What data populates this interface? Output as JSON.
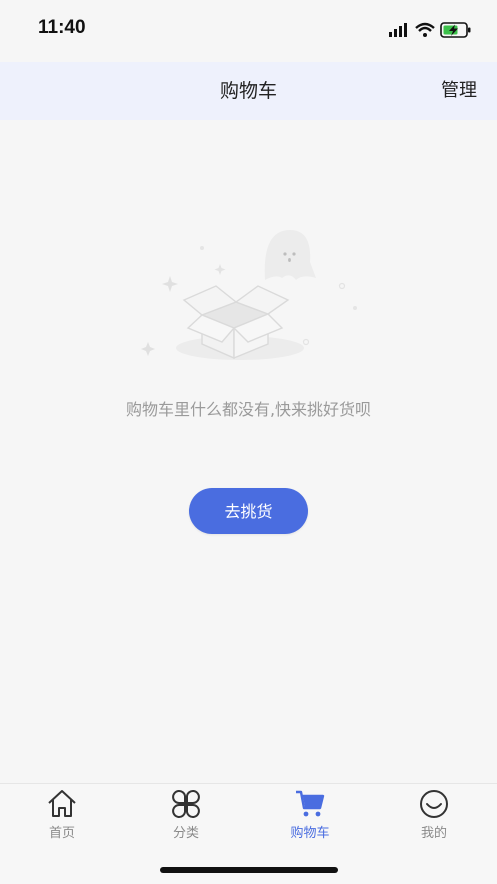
{
  "status_bar": {
    "time": "11:40"
  },
  "nav": {
    "title": "购物车",
    "manage_label": "管理"
  },
  "empty_state": {
    "illustration_icon": "empty-box-ghost-illustration",
    "message": "购物车里什么都没有,快来挑好货呗",
    "button_label": "去挑货"
  },
  "tabs": [
    {
      "label": "首页",
      "icon": "home-icon",
      "active": false
    },
    {
      "label": "分类",
      "icon": "category-icon",
      "active": false
    },
    {
      "label": "购物车",
      "icon": "cart-icon",
      "active": true
    },
    {
      "label": "我的",
      "icon": "profile-icon",
      "active": false
    }
  ],
  "colors": {
    "accent": "#4a6de0",
    "nav_bg": "#eef1fc",
    "page_bg": "#f6f6f6"
  }
}
